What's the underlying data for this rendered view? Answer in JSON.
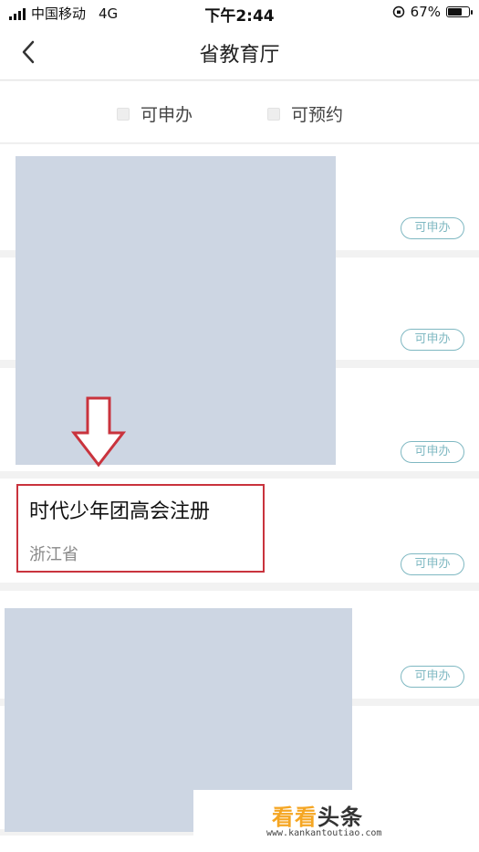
{
  "status_bar": {
    "carrier": "中国移动",
    "network": "4G",
    "time": "下午2:44",
    "battery_percent": "67%",
    "battery_level": 0.67
  },
  "nav": {
    "title": "省教育厅"
  },
  "filters": [
    {
      "label": "可申办",
      "checked": false
    },
    {
      "label": "可预约",
      "checked": false
    }
  ],
  "badge_label": "可申办",
  "items": [
    {
      "badge": "可申办"
    },
    {
      "badge": "可申办"
    },
    {
      "badge": "可申办"
    },
    {
      "title": "时代少年团高会注册",
      "subtitle": "浙江省",
      "badge": "可申办"
    },
    {
      "badge": "可申办"
    }
  ],
  "watermark": {
    "brand_a": "看看",
    "brand_b": "头条",
    "url": "www.kankantoutiao.com"
  },
  "colors": {
    "accent_badge": "#7fb8c2",
    "highlight_red": "#c9333d",
    "redacted_cover": "#cdd6e3"
  }
}
